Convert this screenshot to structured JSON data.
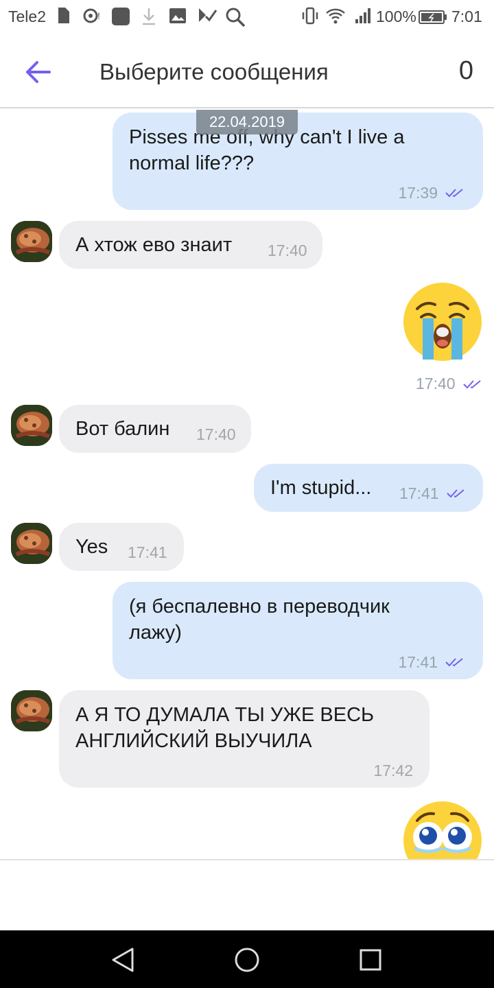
{
  "status_bar": {
    "carrier": "Tele2",
    "battery": "100%",
    "time": "7:01"
  },
  "header": {
    "title": "Выберите сообщения",
    "selected_count": "0"
  },
  "chat": {
    "date_chip": "22.04.2019",
    "messages": [
      {
        "direction": "out",
        "text_lines": [
          "Pisses me off, why can't I live a",
          "normal life???"
        ],
        "time": "17:39",
        "status": "read"
      },
      {
        "direction": "in",
        "text": "А хтож ево знаит",
        "time": "17:40"
      },
      {
        "direction": "out",
        "sticker": "crying-face-sticker",
        "time": "17:40",
        "status": "read"
      },
      {
        "direction": "in",
        "text": "Вот балин",
        "time": "17:40"
      },
      {
        "direction": "out",
        "text": "I'm stupid...",
        "time": "17:41",
        "status": "read"
      },
      {
        "direction": "in",
        "text": "Yes",
        "time": "17:41"
      },
      {
        "direction": "out",
        "text_lines": [
          "(я беспалевно в переводчик",
          "лажу)"
        ],
        "time": "17:41",
        "status": "read"
      },
      {
        "direction": "in",
        "text_lines": [
          "А Я ТО ДУМАЛА ТЫ УЖЕ ВЕСЬ",
          "АНГЛИЙСКИЙ ВЫУЧИЛА"
        ],
        "time": "17:42"
      },
      {
        "direction": "out",
        "sticker": "pleading-face-sticker"
      }
    ]
  },
  "colors": {
    "accent": "#7360f2",
    "outgoing_bubble": "#d9e9fb",
    "incoming_bubble": "#eeedf0",
    "nav_bar": "#000000"
  }
}
